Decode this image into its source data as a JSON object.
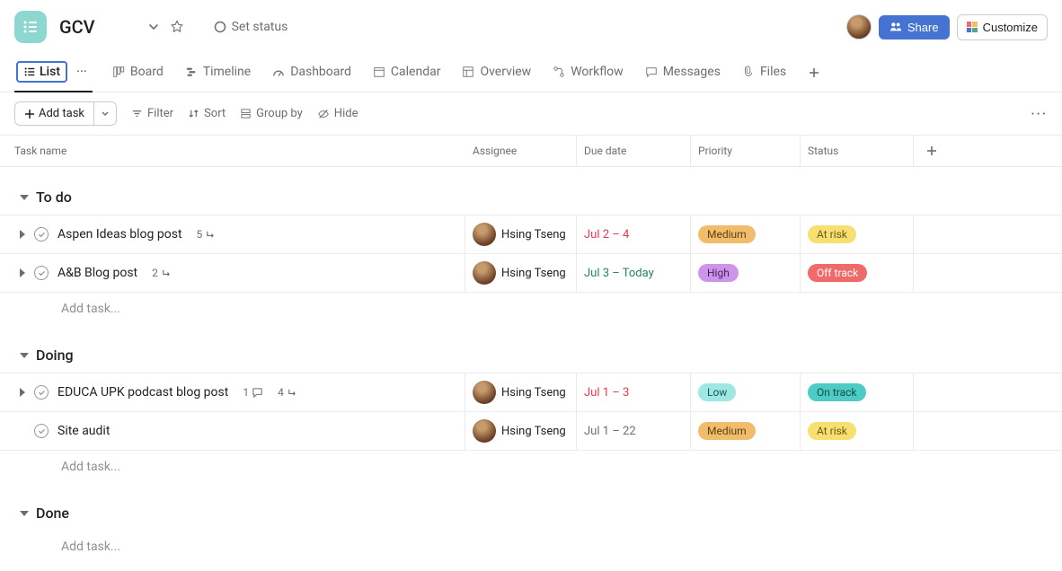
{
  "project": {
    "name": "GCV",
    "status_label": "Set status"
  },
  "header_buttons": {
    "share": "Share",
    "customize": "Customize"
  },
  "tabs": {
    "list": "List",
    "board": "Board",
    "timeline": "Timeline",
    "dashboard": "Dashboard",
    "calendar": "Calendar",
    "overview": "Overview",
    "workflow": "Workflow",
    "messages": "Messages",
    "files": "Files"
  },
  "toolbar": {
    "add_task": "Add task",
    "filter": "Filter",
    "sort": "Sort",
    "group_by": "Group by",
    "hide": "Hide"
  },
  "columns": {
    "name": "Task name",
    "assignee": "Assignee",
    "due": "Due date",
    "priority": "Priority",
    "status": "Status"
  },
  "sections": [
    {
      "title": "To do",
      "tasks": [
        {
          "name": "Aspen Ideas blog post",
          "subtasks": "5",
          "comments": "",
          "assignee": "Hsing Tseng",
          "due": "Jul 2 – 4",
          "due_class": "date-red",
          "priority": "Medium",
          "priority_class": "p-med",
          "status": "At risk",
          "status_class": "s-risk",
          "expandable": true
        },
        {
          "name": "A&B Blog post",
          "subtasks": "2",
          "comments": "",
          "assignee": "Hsing Tseng",
          "due": "Jul 3 – Today",
          "due_class": "date-green",
          "priority": "High",
          "priority_class": "p-high",
          "status": "Off track",
          "status_class": "s-off",
          "expandable": true
        }
      ],
      "add_label": "Add task..."
    },
    {
      "title": "Doing",
      "tasks": [
        {
          "name": "EDUCA UPK podcast blog post",
          "subtasks": "4",
          "comments": "1",
          "assignee": "Hsing Tseng",
          "due": "Jul 1 – 3",
          "due_class": "date-red",
          "priority": "Low",
          "priority_class": "p-low",
          "status": "On track",
          "status_class": "s-on",
          "expandable": true
        },
        {
          "name": "Site audit",
          "subtasks": "",
          "comments": "",
          "assignee": "Hsing Tseng",
          "due": "Jul 1 – 22",
          "due_class": "date-muted",
          "priority": "Medium",
          "priority_class": "p-med",
          "status": "At risk",
          "status_class": "s-risk",
          "expandable": false
        }
      ],
      "add_label": "Add task..."
    },
    {
      "title": "Done",
      "tasks": [],
      "add_label": "Add task..."
    }
  ]
}
